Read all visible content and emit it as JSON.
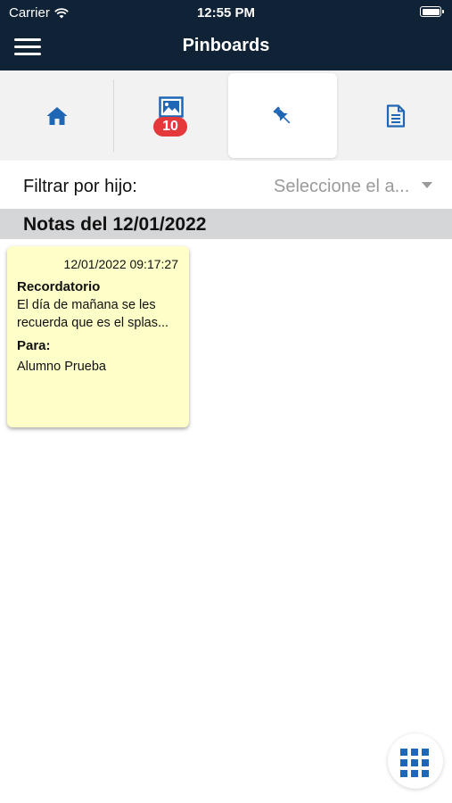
{
  "status_bar": {
    "carrier": "Carrier",
    "time": "12:55 PM"
  },
  "header": {
    "title": "Pinboards"
  },
  "tabs": [
    {
      "name": "home",
      "icon": "home-icon",
      "selected": false
    },
    {
      "name": "gallery",
      "icon": "image-icon",
      "badge": "10",
      "selected": false
    },
    {
      "name": "pinboards",
      "icon": "pushpin-icon",
      "selected": true
    },
    {
      "name": "documents",
      "icon": "document-icon",
      "selected": false
    }
  ],
  "filter": {
    "label": "Filtrar por hijo:",
    "placeholder": "Seleccione el a..."
  },
  "section": {
    "title": "Notas del 12/01/2022"
  },
  "notes": [
    {
      "timestamp": "12/01/2022 09:17:27",
      "heading": "Recordatorio",
      "body": "El día de mañana se les recuerda que es el splas...",
      "to_label": "Para:",
      "to_value": "Alumno Prueba"
    }
  ],
  "fab": {
    "icon": "apps-grid-icon"
  },
  "colors": {
    "topbar": "#0f2236",
    "accent": "#1f66b4",
    "badge": "#e5383b",
    "note": "#fefec8",
    "section": "#d5d6d8"
  }
}
